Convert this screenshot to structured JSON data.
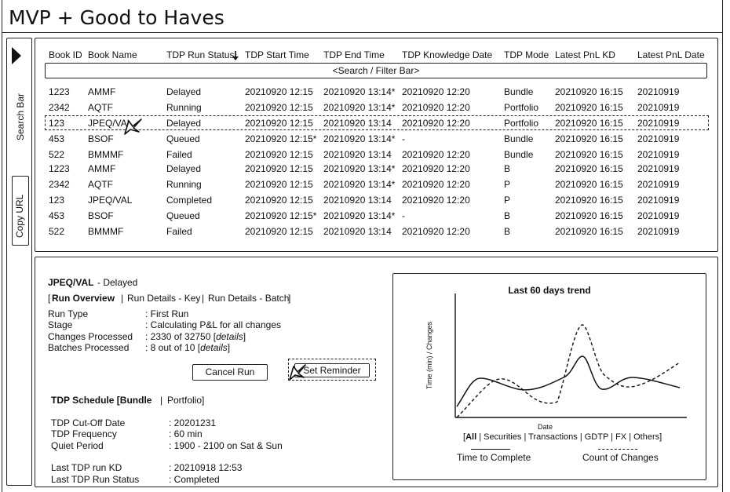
{
  "page": {
    "title": "MVP + Good to Haves"
  },
  "sidebar": {
    "search_label": "Search Bar",
    "copy_url_label": "Copy URL"
  },
  "table": {
    "columns": [
      "Book ID",
      "Book Name",
      "TDP Run Status",
      "TDP Start Time",
      "TDP End Time",
      "TDP Knowledge Date",
      "TDP Mode",
      "Latest PnL KD",
      "Latest PnL Date"
    ],
    "search_placeholder": "<Search / Filter Bar>",
    "rows": [
      [
        "1223",
        "AMMF",
        "Delayed",
        "20210920 12:15",
        "20210920 13:14*",
        "20210920 12:20",
        "Bundle",
        "20210920 16:15",
        "20210919"
      ],
      [
        "2342",
        "AQTF",
        "Running",
        "20210920 12:15",
        "20210920 13:14*",
        "20210920 12:20",
        "Portfolio",
        "20210920 16:15",
        "20210919"
      ],
      [
        "123",
        "JPEQ/VAL",
        "Delayed",
        "20210920 12:15",
        "20210920 13:14",
        "20210920 12:20",
        "Portfolio",
        "20210920 16:15",
        "20210919"
      ],
      [
        "453",
        "BSOF",
        "Queued",
        "20210920 12:15*",
        "20210920 13:14*",
        "-",
        "Bundle",
        "20210920 16:15",
        "20210919"
      ],
      [
        "522",
        "BMMMF",
        "Failed",
        "20210920 12:15",
        "20210920 13:14",
        "20210920 12:20",
        "Bundle",
        "20210920 16:15",
        "20210919"
      ],
      [
        "1223",
        "AMMF",
        "Delayed",
        "20210920 12:15",
        "20210920 13:14*",
        "20210920 12:20",
        "B",
        "20210920 16:15",
        "20210919"
      ],
      [
        "2342",
        "AQTF",
        "Running",
        "20210920 12:15",
        "20210920 13:14*",
        "20210920 12:20",
        "P",
        "20210920 16:15",
        "20210919"
      ],
      [
        "123",
        "JPEQ/VAL",
        "Completed",
        "20210920 12:15",
        "20210920 13:14",
        "20210920 12:20",
        "P",
        "20210920 16:15",
        "20210919"
      ],
      [
        "453",
        "BSOF",
        "Queued",
        "20210920 12:15*",
        "20210920 13:14*",
        "-",
        "B",
        "20210920 16:15",
        "20210919"
      ],
      [
        "522",
        "BMMMF",
        "Failed",
        "20210920 12:15",
        "20210920 13:14",
        "20210920 12:20",
        "B",
        "20210920 16:15",
        "20210919"
      ]
    ],
    "selected_row": 2
  },
  "detail": {
    "book_name": "JPEQ/VAL",
    "status": "- Delayed",
    "tabs": {
      "open": "[",
      "overview": "Run Overview",
      "sep1": "|",
      "key": "Run Details - Key",
      "sep2": "|",
      "batch": "Run Details - Batch",
      "close": "]"
    },
    "run_type_label": "Run Type",
    "run_type_value": ": First Run",
    "stage_label": "Stage",
    "stage_value": ": Calculating P&L for all changes",
    "changes_label": "Changes Processed",
    "changes_value": ": 2330 of 32750 [",
    "changes_link": "details",
    "changes_close": "]",
    "batches_label": "Batches Processed",
    "batches_value": ": 8 out of 10 [",
    "batches_link": "details",
    "batches_close": "]",
    "cancel_button": "Cancel Run",
    "reminder_button": "Set Reminder",
    "schedule_title": "TDP Schedule [Bundle",
    "schedule_sep": "|",
    "schedule_alt": "Portfolio]",
    "cutoff_label": "TDP Cut-Off Date",
    "cutoff_value": ": 20201231",
    "frequency_label": "TDP Frequency",
    "frequency_value": ": 60 min",
    "quiet_label": "Quiet Period",
    "quiet_value": ": 1900 - 2100 on Sat & Sun",
    "last_kd_label": "Last TDP run KD",
    "last_kd_value": ": 20210918 12:53",
    "last_status_label": "Last TDP Run Status",
    "last_status_value": ": Completed"
  },
  "trend": {
    "title": "Last 60 days trend",
    "ylabel": "Time (min) / Changes",
    "xlabel": "Date",
    "filters": {
      "open": "[",
      "all": "All",
      "securities": "| Securities",
      "transactions": "| Transactions",
      "gdtp": "| GDTP",
      "fx": "| FX",
      "others": "| Others]"
    },
    "legend_solid": "Time to Complete",
    "legend_dashed": "Count of Changes"
  }
}
